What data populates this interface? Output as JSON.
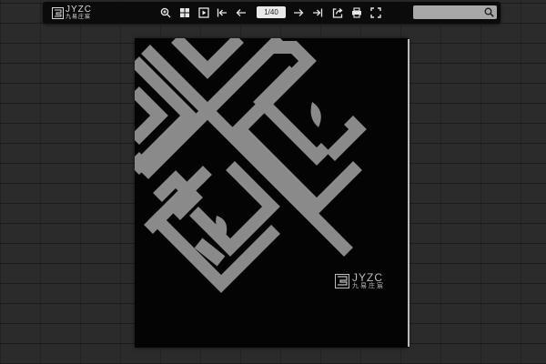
{
  "brand": {
    "name": "JYZC",
    "subtitle": "九易庄宸"
  },
  "toolbar": {
    "buttons": [
      {
        "name": "zoom-in",
        "icon": "zoom-in-icon"
      },
      {
        "name": "thumbnails",
        "icon": "thumbnails-icon"
      },
      {
        "name": "autoplay",
        "icon": "play-icon"
      },
      {
        "name": "first-page",
        "icon": "first-page-icon"
      },
      {
        "name": "previous-page",
        "icon": "arrow-left-icon"
      },
      {
        "name": "next-page",
        "icon": "arrow-right-icon"
      },
      {
        "name": "last-page",
        "icon": "last-page-icon"
      },
      {
        "name": "share",
        "icon": "share-icon"
      },
      {
        "name": "print",
        "icon": "print-icon"
      },
      {
        "name": "fullscreen",
        "icon": "fullscreen-icon"
      }
    ],
    "page_indicator": "1/40"
  },
  "search": {
    "value": "",
    "icon": "search-icon"
  },
  "cover": {
    "pattern_color": "#8a8a8a",
    "background": "#040404",
    "logo_text": "JYZC",
    "logo_subtitle": "九易庄宸"
  }
}
